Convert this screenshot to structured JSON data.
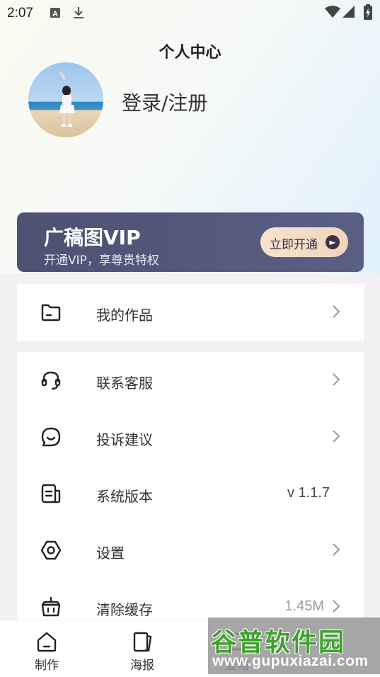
{
  "status_bar": {
    "time": "2:07",
    "icons": [
      "a-notification-icon",
      "download-icon",
      "wifi-icon",
      "signal-icon",
      "battery-icon"
    ]
  },
  "header": {
    "title": "个人中心",
    "login_text": "登录/注册"
  },
  "vip": {
    "title": "广稿图VIP",
    "subtitle": "开通VIP，享尊贵特权",
    "button_label": "立即开通"
  },
  "menu_primary": [
    {
      "label": "我的作品",
      "icon": "folder-icon"
    }
  ],
  "menu_secondary": [
    {
      "label": "联系客服",
      "icon": "headset-icon"
    },
    {
      "label": "投诉建议",
      "icon": "chat-bubble-icon"
    },
    {
      "label": "系统版本",
      "icon": "version-icon",
      "value": "v 1.1.7"
    },
    {
      "label": "设置",
      "icon": "settings-icon"
    },
    {
      "label": "清除缓存",
      "icon": "basket-icon",
      "value": "1.45M"
    }
  ],
  "bottom_nav": [
    {
      "label": "制作",
      "icon": "home-icon"
    },
    {
      "label": "海报",
      "icon": "poster-icon"
    },
    {
      "label": "壹帽",
      "icon": "template-icon"
    }
  ],
  "watermark": {
    "title": "谷普软件园",
    "url": "www.gupuxiazai.com"
  },
  "colors": {
    "vip_card": "#50547a",
    "vip_button": "#f3ddc5",
    "watermark_green": "#3fa12c"
  }
}
